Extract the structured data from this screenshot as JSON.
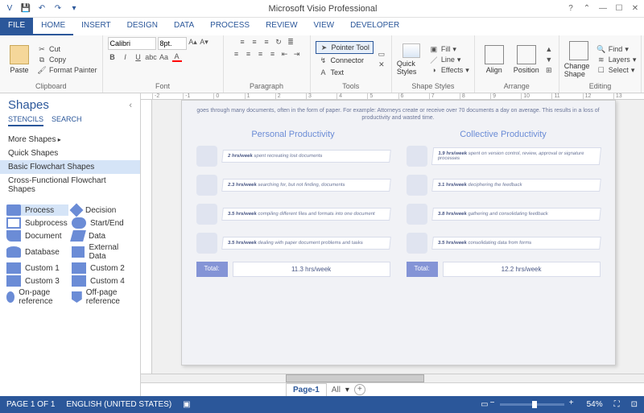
{
  "title_bar": {
    "app_title": "Microsoft Visio Professional"
  },
  "ribbon_tabs": {
    "file": "FILE",
    "home": "HOME",
    "insert": "INSERT",
    "design": "DESIGN",
    "data": "DATA",
    "process": "PROCESS",
    "review": "REVIEW",
    "view": "VIEW",
    "developer": "DEVELOPER"
  },
  "ribbon": {
    "clipboard": {
      "paste": "Paste",
      "cut": "Cut",
      "copy": "Copy",
      "format_painter": "Format Painter",
      "group": "Clipboard"
    },
    "font": {
      "face": "Calibri",
      "size": "8pt.",
      "group": "Font"
    },
    "paragraph": {
      "group": "Paragraph"
    },
    "tools": {
      "pointer": "Pointer Tool",
      "connector": "Connector",
      "text": "Text",
      "group": "Tools"
    },
    "shape_styles": {
      "quick": "Quick Styles",
      "fill": "Fill",
      "line": "Line",
      "effects": "Effects",
      "group": "Shape Styles"
    },
    "arrange": {
      "align": "Align",
      "position": "Position",
      "group": "Arrange"
    },
    "editing": {
      "change": "Change Shape",
      "find": "Find",
      "layers": "Layers",
      "select": "Select",
      "group": "Editing"
    }
  },
  "shapes_panel": {
    "title": "Shapes",
    "tab_stencils": "STENCILS",
    "tab_search": "SEARCH",
    "stencils": {
      "more": "More Shapes",
      "quick": "Quick Shapes",
      "basic": "Basic Flowchart Shapes",
      "cross": "Cross-Functional Flowchart Shapes"
    },
    "shapes": {
      "process": "Process",
      "decision": "Decision",
      "subprocess": "Subprocess",
      "startend": "Start/End",
      "document": "Document",
      "data": "Data",
      "database": "Database",
      "external": "External Data",
      "custom1": "Custom 1",
      "custom2": "Custom 2",
      "custom3": "Custom 3",
      "custom4": "Custom 4",
      "onpage": "On-page reference",
      "offpage": "Off-page reference"
    }
  },
  "canvas": {
    "intro": "goes through many documents, often in the form of paper. For example: Attorneys create or receive over 70 documents a day on average. This results in a loss of productivity and wasted time.",
    "col1_title": "Personal Productivity",
    "col2_title": "Collective Productivity",
    "col1": [
      {
        "bold": "2 hrs/week",
        "rest": "spent recreating lost documents"
      },
      {
        "bold": "2.3 hrs/week",
        "rest": "searching for, but not finding, documents"
      },
      {
        "bold": "3.5 hrs/week",
        "rest": "compiling different files and formats into one document"
      },
      {
        "bold": "3.5 hrs/week",
        "rest": "dealing with paper document problems and tasks"
      }
    ],
    "col2": [
      {
        "bold": "1.9 hrs/week",
        "rest": "spent on version control, review, approval or signature processes"
      },
      {
        "bold": "3.1 hrs/week",
        "rest": "deciphering the feedback"
      },
      {
        "bold": "3.8 hrs/week",
        "rest": "gathering and consolidating feedback"
      },
      {
        "bold": "3.5 hrs/week",
        "rest": "consolidating data from forms"
      }
    ],
    "total_label": "Total:",
    "total1": "11.3 hrs/week",
    "total2": "12.2 hrs/week"
  },
  "page_tabs": {
    "page1": "Page-1",
    "all": "All"
  },
  "status": {
    "page": "PAGE 1 OF 1",
    "lang": "ENGLISH (UNITED STATES)",
    "zoom": "54%"
  },
  "ruler_marks": [
    "-2",
    "-1",
    "0",
    "1",
    "2",
    "3",
    "4",
    "5",
    "6",
    "7",
    "8",
    "9",
    "10",
    "11",
    "12",
    "13"
  ]
}
